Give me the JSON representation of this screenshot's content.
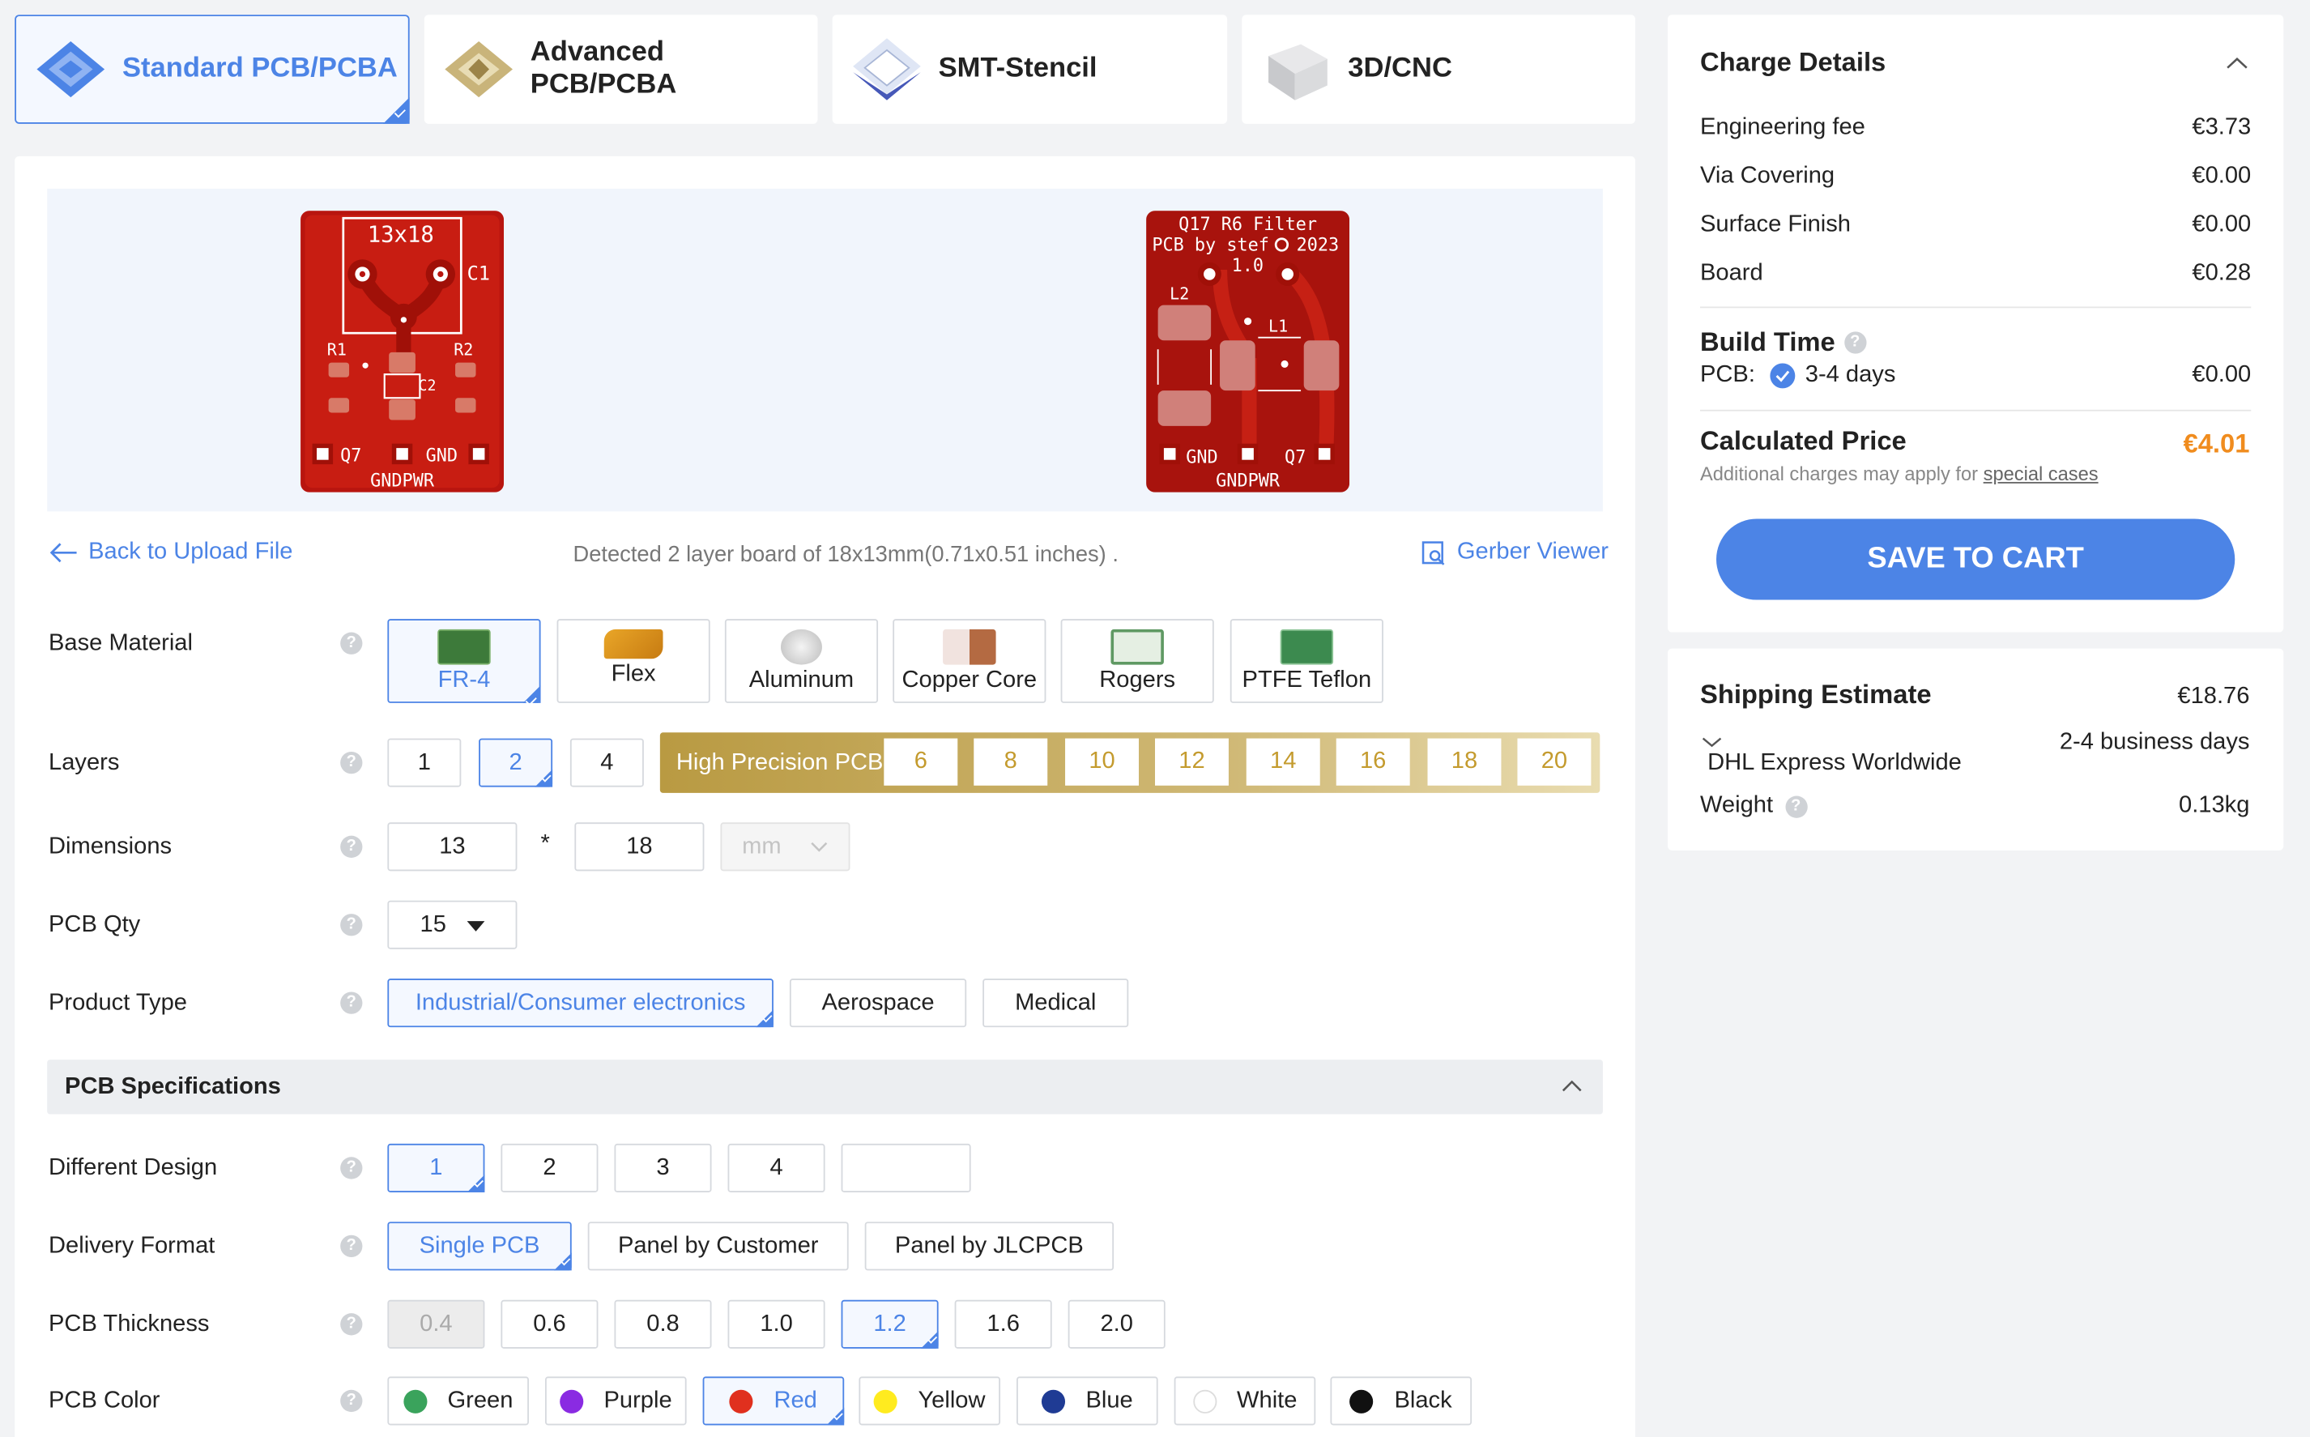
{
  "tabs": [
    {
      "label": "Standard PCB/PCBA",
      "icon": "standard-pcb-icon"
    },
    {
      "label": "Advanced PCB/PCBA",
      "icon": "advanced-pcb-icon"
    },
    {
      "label": "SMT-Stencil",
      "icon": "smt-stencil-icon"
    },
    {
      "label": "3D/CNC",
      "icon": "3d-cnc-icon"
    }
  ],
  "preview": {
    "front": {
      "size": "13x18",
      "c1": "C1",
      "r1": "R1",
      "r2": "R2",
      "c2": "C2",
      "q7": "Q7",
      "gnd": "GND",
      "gndpwr": "GNDPWR"
    },
    "back": {
      "title1": "Q17 R6 Filter",
      "title2": "PCB by stef",
      "year": "2023",
      "ver": "1.0",
      "l2": "L2",
      "l1": "L1",
      "gnd": "GND",
      "q7": "Q7",
      "gndpwr": "GNDPWR"
    }
  },
  "upload": {
    "back_label": "Back to Upload File",
    "detected": "Detected 2 layer board of 18x13mm(0.71x0.51 inches) .",
    "gerber": "Gerber Viewer"
  },
  "base_material": {
    "label": "Base Material",
    "options": [
      "FR-4",
      "Flex",
      "Aluminum",
      "Copper Core",
      "Rogers",
      "PTFE Teflon"
    ]
  },
  "layers": {
    "label": "Layers",
    "options": [
      "1",
      "2",
      "4"
    ],
    "hp_label": "High Precision PCB",
    "hp_options": [
      "6",
      "8",
      "10",
      "12",
      "14",
      "16",
      "18",
      "20"
    ]
  },
  "dimensions": {
    "label": "Dimensions",
    "width": "13",
    "height": "18",
    "sep": "*",
    "unit": "mm"
  },
  "qty": {
    "label": "PCB Qty",
    "value": "15"
  },
  "product_type": {
    "label": "Product Type",
    "options": [
      "Industrial/Consumer electronics",
      "Aerospace",
      "Medical"
    ]
  },
  "specs": {
    "title": "PCB Specifications"
  },
  "different_design": {
    "label": "Different Design",
    "options": [
      "1",
      "2",
      "3",
      "4"
    ]
  },
  "delivery": {
    "label": "Delivery Format",
    "options": [
      "Single PCB",
      "Panel by Customer",
      "Panel by JLCPCB"
    ]
  },
  "thickness": {
    "label": "PCB Thickness",
    "options": [
      "0.4",
      "0.6",
      "0.8",
      "1.0",
      "1.2",
      "1.6",
      "2.0"
    ]
  },
  "color": {
    "label": "PCB Color",
    "options": [
      {
        "name": "Green",
        "hex": "#3aa35c"
      },
      {
        "name": "Purple",
        "hex": "#8a2be2"
      },
      {
        "name": "Red",
        "hex": "#e0301e"
      },
      {
        "name": "Yellow",
        "hex": "#ffeb1f"
      },
      {
        "name": "Blue",
        "hex": "#1f3b94"
      },
      {
        "name": "White",
        "hex": "#ffffff"
      },
      {
        "name": "Black",
        "hex": "#111111"
      }
    ]
  },
  "charge": {
    "title": "Charge Details",
    "items": [
      {
        "name": "Engineering fee",
        "value": "€3.73"
      },
      {
        "name": "Via Covering",
        "value": "€0.00"
      },
      {
        "name": "Surface Finish",
        "value": "€0.00"
      },
      {
        "name": "Board",
        "value": "€0.28"
      }
    ],
    "build_title": "Build Time",
    "pcb_label": "PCB:",
    "build_days": "3-4 days",
    "build_price": "€0.00",
    "calc_title": "Calculated Price",
    "calc_price": "€4.01",
    "note": "Additional charges may apply for",
    "note_link": "special cases",
    "cart": "SAVE TO CART"
  },
  "shipping": {
    "title": "Shipping Estimate",
    "price": "€18.76",
    "days": "2-4 business days",
    "carrier": "DHL Express Worldwide",
    "weight_label": "Weight",
    "weight": "0.13kg"
  },
  "colors": {
    "accent": "#4c84e6",
    "orange": "#f08c1e",
    "pcb_red": "#b8150f"
  }
}
